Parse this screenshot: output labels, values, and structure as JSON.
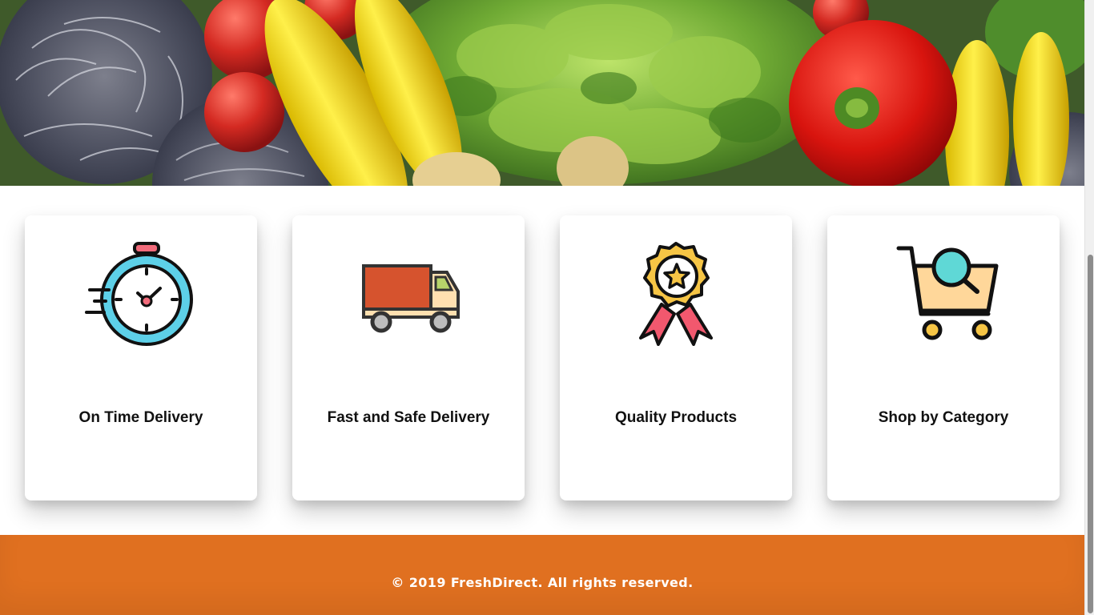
{
  "hero": {
    "image": "vegetables-banner"
  },
  "features": [
    {
      "title": "On Time Delivery",
      "icon": "stopwatch-icon"
    },
    {
      "title": "Fast and Safe Delivery",
      "icon": "delivery-truck-icon"
    },
    {
      "title": "Quality Products",
      "icon": "award-badge-icon"
    },
    {
      "title": "Shop by Category",
      "icon": "cart-search-icon"
    }
  ],
  "footer": {
    "copyright": "© 2019 FreshDirect. All rights reserved."
  },
  "colors": {
    "footer_bg": "#e07020",
    "card_bg": "#ffffff",
    "text": "#111111"
  }
}
